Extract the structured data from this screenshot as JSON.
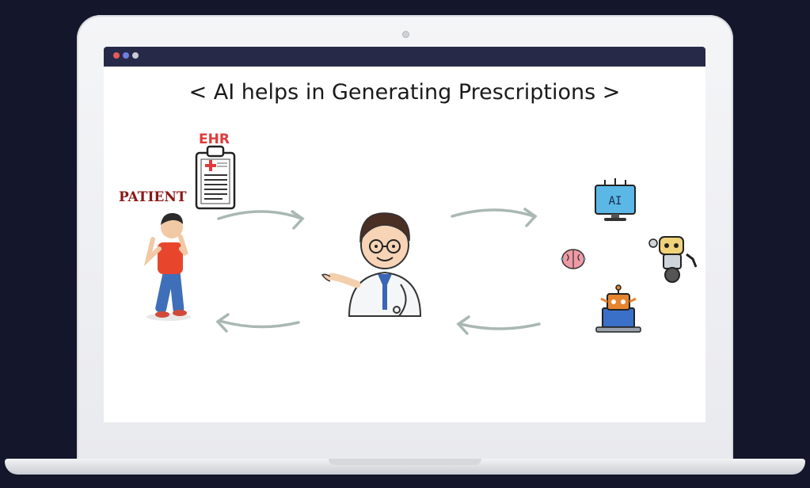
{
  "slide": {
    "title": "< AI helps in Generating Prescriptions >",
    "ehr_label": "EHR",
    "patient_label": "PATIENT",
    "ai_screen_text": "AI"
  },
  "colors": {
    "background": "#14172b",
    "browser_bar": "#262a48",
    "arrow": "#a9b8b3",
    "ehr_red": "#e23a3a",
    "patient_red": "#8a1818"
  },
  "icons": [
    "clipboard-icon",
    "patient-figure",
    "doctor-figure",
    "ai-monitor-icon",
    "brain-icon",
    "robot-icon",
    "laptop-robot-icon"
  ]
}
